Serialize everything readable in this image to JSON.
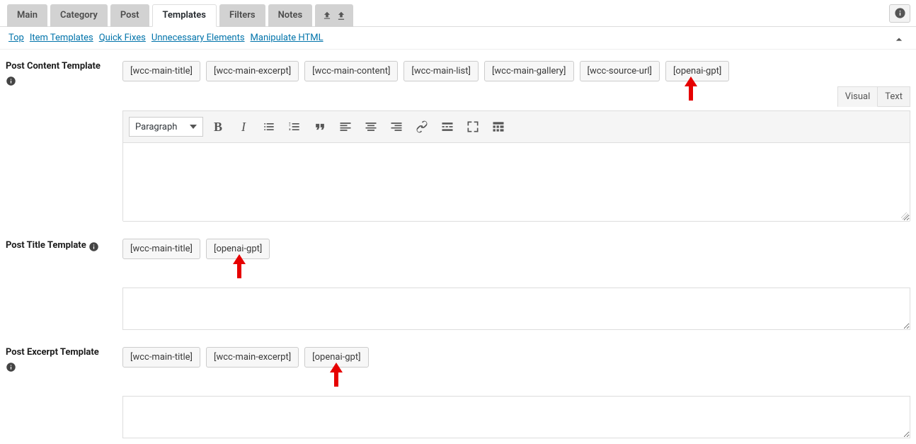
{
  "tabs": {
    "main": "Main",
    "category": "Category",
    "post": "Post",
    "templates": "Templates",
    "filters": "Filters",
    "notes": "Notes"
  },
  "anchors": {
    "top": "Top",
    "item_templates": "Item Templates",
    "quick_fixes": "Quick Fixes",
    "unnecessary_elements": "Unnecessary Elements",
    "manipulate_html": "Manipulate HTML"
  },
  "sections": {
    "content": {
      "label": "Post Content Template",
      "chips": [
        "[wcc-main-title]",
        "[wcc-main-excerpt]",
        "[wcc-main-content]",
        "[wcc-main-list]",
        "[wcc-main-gallery]",
        "[wcc-source-url]",
        "[openai-gpt]"
      ]
    },
    "title": {
      "label": "Post Title Template",
      "chips": [
        "[wcc-main-title]",
        "[openai-gpt]"
      ]
    },
    "excerpt": {
      "label": "Post Excerpt Template",
      "chips": [
        "[wcc-main-title]",
        "[wcc-main-excerpt]",
        "[openai-gpt]"
      ]
    }
  },
  "editor": {
    "format_label": "Paragraph",
    "visual_tab": "Visual",
    "text_tab": "Text"
  }
}
